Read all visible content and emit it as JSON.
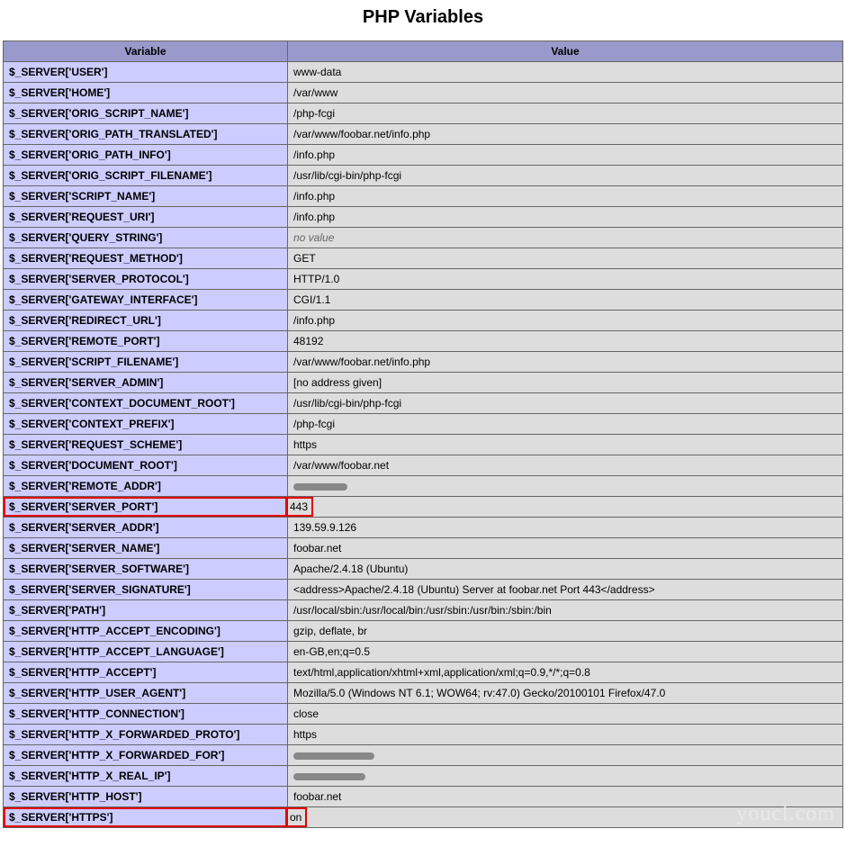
{
  "title": "PHP Variables",
  "headers": {
    "variable": "Variable",
    "value": "Value"
  },
  "watermark": "youcl.com",
  "rows": [
    {
      "variable": "$_SERVER['USER']",
      "value": "www-data"
    },
    {
      "variable": "$_SERVER['HOME']",
      "value": "/var/www"
    },
    {
      "variable": "$_SERVER['ORIG_SCRIPT_NAME']",
      "value": "/php-fcgi"
    },
    {
      "variable": "$_SERVER['ORIG_PATH_TRANSLATED']",
      "value": "/var/www/foobar.net/info.php"
    },
    {
      "variable": "$_SERVER['ORIG_PATH_INFO']",
      "value": "/info.php"
    },
    {
      "variable": "$_SERVER['ORIG_SCRIPT_FILENAME']",
      "value": "/usr/lib/cgi-bin/php-fcgi"
    },
    {
      "variable": "$_SERVER['SCRIPT_NAME']",
      "value": "/info.php"
    },
    {
      "variable": "$_SERVER['REQUEST_URI']",
      "value": "/info.php"
    },
    {
      "variable": "$_SERVER['QUERY_STRING']",
      "value": "no value",
      "noValue": true
    },
    {
      "variable": "$_SERVER['REQUEST_METHOD']",
      "value": "GET"
    },
    {
      "variable": "$_SERVER['SERVER_PROTOCOL']",
      "value": "HTTP/1.0"
    },
    {
      "variable": "$_SERVER['GATEWAY_INTERFACE']",
      "value": "CGI/1.1"
    },
    {
      "variable": "$_SERVER['REDIRECT_URL']",
      "value": "/info.php"
    },
    {
      "variable": "$_SERVER['REMOTE_PORT']",
      "value": "48192"
    },
    {
      "variable": "$_SERVER['SCRIPT_FILENAME']",
      "value": "/var/www/foobar.net/info.php"
    },
    {
      "variable": "$_SERVER['SERVER_ADMIN']",
      "value": "[no address given]"
    },
    {
      "variable": "$_SERVER['CONTEXT_DOCUMENT_ROOT']",
      "value": "/usr/lib/cgi-bin/php-fcgi"
    },
    {
      "variable": "$_SERVER['CONTEXT_PREFIX']",
      "value": "/php-fcgi"
    },
    {
      "variable": "$_SERVER['REQUEST_SCHEME']",
      "value": "https"
    },
    {
      "variable": "$_SERVER['DOCUMENT_ROOT']",
      "value": "/var/www/foobar.net"
    },
    {
      "variable": "$_SERVER['REMOTE_ADDR']",
      "value": "",
      "redacted": "w1"
    },
    {
      "variable": "$_SERVER['SERVER_PORT']",
      "value": "443",
      "highlighted": true
    },
    {
      "variable": "$_SERVER['SERVER_ADDR']",
      "value": "139.59.9.126"
    },
    {
      "variable": "$_SERVER['SERVER_NAME']",
      "value": "foobar.net"
    },
    {
      "variable": "$_SERVER['SERVER_SOFTWARE']",
      "value": "Apache/2.4.18 (Ubuntu)"
    },
    {
      "variable": "$_SERVER['SERVER_SIGNATURE']",
      "value": "<address>Apache/2.4.18 (Ubuntu) Server at foobar.net Port 443</address>"
    },
    {
      "variable": "$_SERVER['PATH']",
      "value": "/usr/local/sbin:/usr/local/bin:/usr/sbin:/usr/bin:/sbin:/bin"
    },
    {
      "variable": "$_SERVER['HTTP_ACCEPT_ENCODING']",
      "value": "gzip, deflate, br"
    },
    {
      "variable": "$_SERVER['HTTP_ACCEPT_LANGUAGE']",
      "value": "en-GB,en;q=0.5"
    },
    {
      "variable": "$_SERVER['HTTP_ACCEPT']",
      "value": "text/html,application/xhtml+xml,application/xml;q=0.9,*/*;q=0.8"
    },
    {
      "variable": "$_SERVER['HTTP_USER_AGENT']",
      "value": "Mozilla/5.0 (Windows NT 6.1; WOW64; rv:47.0) Gecko/20100101 Firefox/47.0"
    },
    {
      "variable": "$_SERVER['HTTP_CONNECTION']",
      "value": "close"
    },
    {
      "variable": "$_SERVER['HTTP_X_FORWARDED_PROTO']",
      "value": "https"
    },
    {
      "variable": "$_SERVER['HTTP_X_FORWARDED_FOR']",
      "value": "",
      "redacted": "w2"
    },
    {
      "variable": "$_SERVER['HTTP_X_REAL_IP']",
      "value": "",
      "redacted": "w3"
    },
    {
      "variable": "$_SERVER['HTTP_HOST']",
      "value": "foobar.net"
    },
    {
      "variable": "$_SERVER['HTTPS']",
      "value": "on",
      "highlighted": true
    }
  ]
}
